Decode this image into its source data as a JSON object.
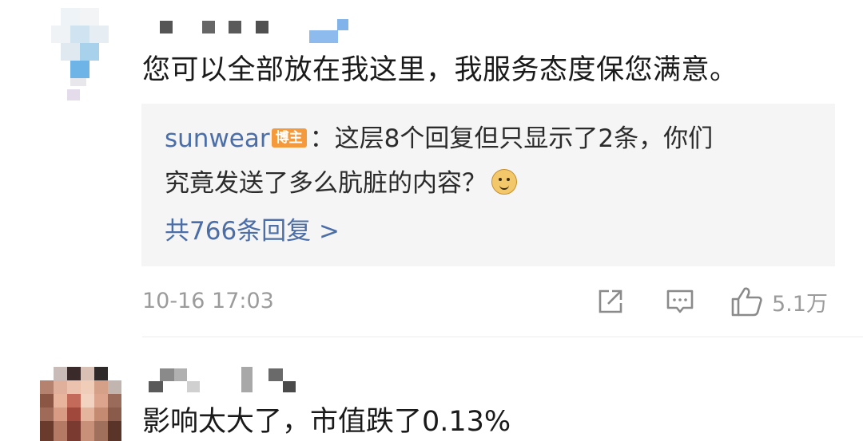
{
  "comment1": {
    "text": "您可以全部放在我这里，我服务态度保您满意。",
    "reply": {
      "username": "sunwear",
      "badge": "博主",
      "line1_rest": "：这层8个回复但只显示了2条，你们",
      "line2": "究竟发送了多么肮脏的内容？",
      "emoji": "doge-emoji",
      "more": "共766条回复 >"
    },
    "time": "10-16 17:03",
    "likes": "5.1万"
  },
  "comment2": {
    "text": "影响太大了，市值跌了0.13%"
  },
  "colors": {
    "link": "#4b6ea8",
    "badge": "#f59a3c",
    "meta": "#9b9b9b",
    "reply_bg": "#f5f5f5"
  }
}
